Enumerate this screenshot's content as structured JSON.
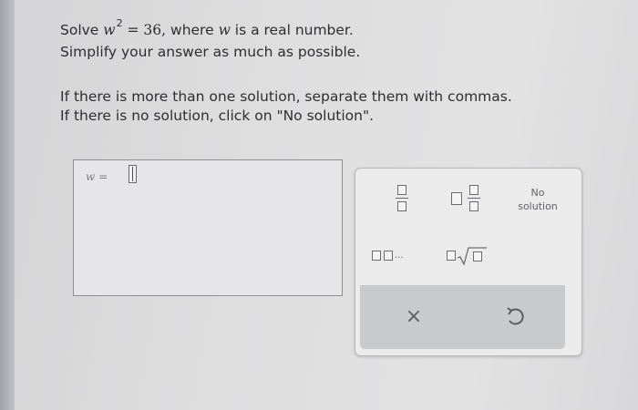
{
  "prompt": {
    "solve_word": "Solve",
    "equation_var": "w",
    "equation_exponent": "2",
    "equation_rest": "= 36,",
    "where_text": "where",
    "where_var": "w",
    "condition_rest": "is a real number.",
    "simplify": "Simplify your answer as much as possible."
  },
  "instructions": {
    "line1": "If there is more than one solution, separate them with commas.",
    "line2": "If there is no solution, click on \"No solution\"."
  },
  "answer": {
    "variable": "w",
    "equals": "=",
    "value": ""
  },
  "keypad": {
    "no_solution_line1": "No",
    "no_solution_line2": "solution",
    "ellipsis": "...",
    "clear_symbol": "×",
    "icons": [
      "fraction-icon",
      "mixed-number-icon",
      "no-solution-button",
      "list-icon",
      "nth-root-icon",
      "clear-icon",
      "undo-icon"
    ]
  }
}
